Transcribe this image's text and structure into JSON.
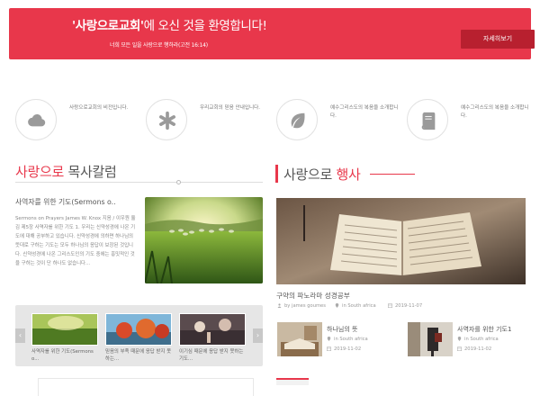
{
  "banner": {
    "title_bold": "'사랑으로교회'",
    "title_rest": "에 오신 것을 환영합니다!",
    "subtitle": "너희 모든 일을 사랑으로 행하라(고전 16:14)",
    "button_label": "자세히보기"
  },
  "features": [
    {
      "icon": "cloud-icon",
      "text": "사랑으로교회의 비전입니다."
    },
    {
      "icon": "asterisk-icon",
      "text": "우리교회의 믿음 안내입니다."
    },
    {
      "icon": "leaf-icon",
      "text": "예수그리스도의 복음을 소개합니다."
    },
    {
      "icon": "book-icon",
      "text": "예수그리스도의 복음을 소개합니다."
    }
  ],
  "column": {
    "heading_red": "사랑으로",
    "heading_rest": " 목사칼럼",
    "article_title": "사역자를 위한 기도(Sermons o..",
    "article_body": "Sermons on Prayers James W. Knox 지음 / 이우원 옮김 제5장 사역자를 위한 기도 1. 우리는 신약성경에 나온 기도에 대해 공부하고 있습니다. 신약성경에 의하면 하나님의 뜻대로 구하는 기도는 모두 하나님의 응답이 보장된 것입니다. 신약성경에 나온 그리스도인의 기도 중에는 흥밋적인 것을 구하는 것이 단 하나도 없습니다...",
    "carousel": [
      {
        "caption": "사역자를 위한 기도(Sermons o..."
      },
      {
        "caption": "믿음의 부족 때문에 응답 받지 못하는..."
      },
      {
        "caption": "이기심 때문에 응답 받지 못하는 기도..."
      }
    ]
  },
  "events": {
    "heading_red_prefix": "사랑으로",
    "heading_red": "행사",
    "main_title": "구약의 파노라마 성경공부",
    "main_author": "by james goumes",
    "main_location": "in South africa",
    "main_date": "2019-11-07",
    "items": [
      {
        "title": "하나님의 뜻",
        "location": "in South africa",
        "date": "2019-11-02"
      },
      {
        "title": "사역자를 위한 기도1",
        "location": "in South africa",
        "date": "2019-11-02"
      }
    ]
  },
  "colors": {
    "accent": "#e8374b",
    "accent_dark": "#b8202f"
  }
}
